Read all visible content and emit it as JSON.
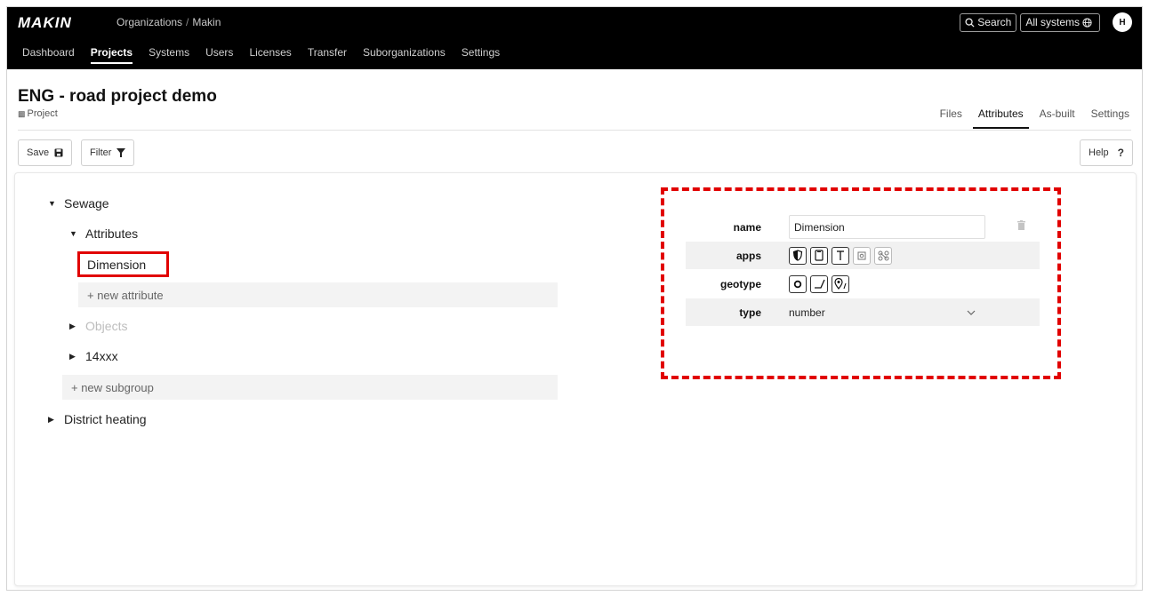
{
  "header": {
    "breadcrumb": [
      "Organizations",
      "Makin"
    ],
    "breadcrumb_sep": "/",
    "nav": [
      "Dashboard",
      "Projects",
      "Systems",
      "Users",
      "Licenses",
      "Transfer",
      "Suborganizations",
      "Settings"
    ],
    "active_nav": "Projects",
    "search_label": "Search",
    "systems_label": "All systems",
    "avatar_initial": "H",
    "logo_text": "MAKIN"
  },
  "page": {
    "title": "ENG - road project demo",
    "subtitle": "Project",
    "tabs": [
      "Files",
      "Attributes",
      "As-built",
      "Settings"
    ],
    "active_tab": "Attributes"
  },
  "toolbar": {
    "save_label": "Save",
    "filter_label": "Filter",
    "help_label": "Help",
    "help_glyph": "?"
  },
  "tree": {
    "sewage": "Sewage",
    "attributes": "Attributes",
    "dimension": "Dimension",
    "new_attribute": "+ new attribute",
    "objects": "Objects",
    "group_14": "14xxx",
    "new_subgroup": "+ new subgroup",
    "district_heating": "District heating"
  },
  "properties": {
    "name_label": "name",
    "name_value": "Dimension",
    "apps_label": "apps",
    "geotype_label": "geotype",
    "type_label": "type",
    "type_value": "number"
  },
  "colors": {
    "annotation_red": "#e10000",
    "header_bg": "#000000"
  }
}
